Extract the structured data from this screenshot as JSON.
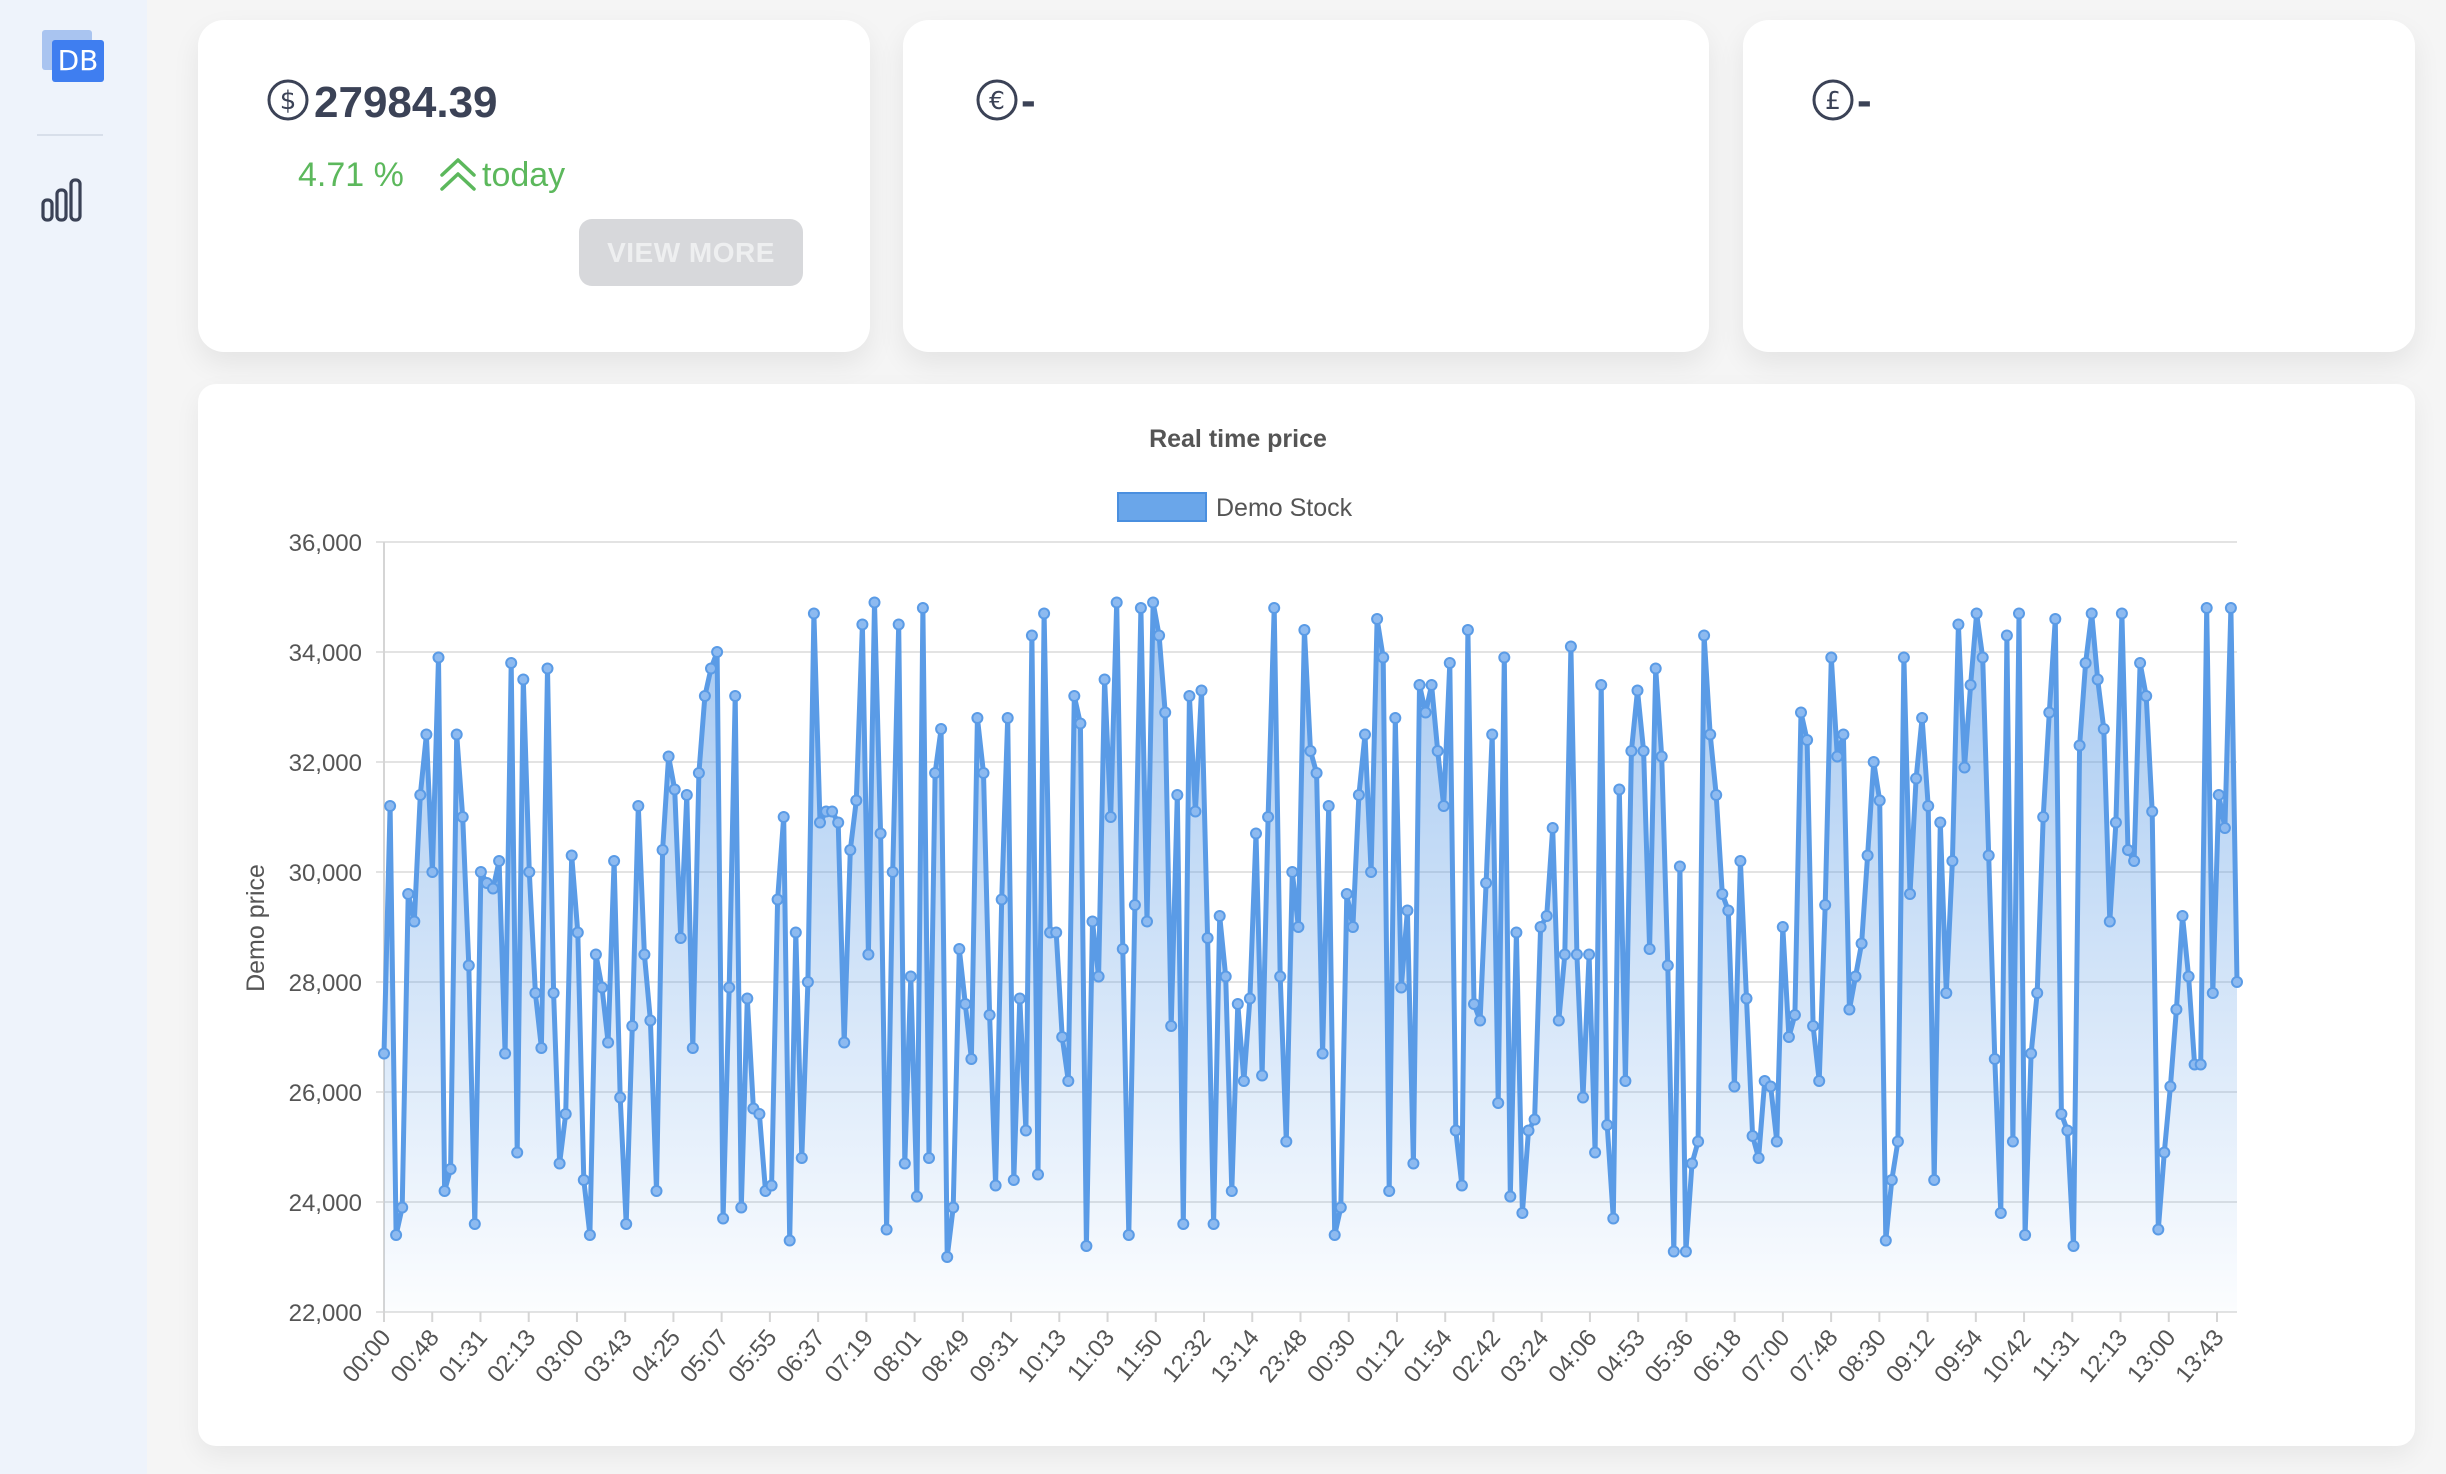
{
  "sidebar": {
    "logo_text": "DB",
    "items": [
      {
        "icon": "bar-chart-icon"
      }
    ]
  },
  "cards": [
    {
      "currency_icon": "dollar-circle-icon",
      "price": "27984.39",
      "change_pct": "4.71 %",
      "arrow_icon": "double-chevron-up-icon",
      "period": "today",
      "button_label": "VIEW MORE"
    },
    {
      "currency_icon": "euro-circle-icon",
      "price": "-"
    },
    {
      "currency_icon": "pound-circle-icon",
      "price": "-"
    }
  ],
  "colors": {
    "line": "#5a9be6",
    "positive": "#5cb85c",
    "logo": "#3f7ef0",
    "sidebar_bg": "#eef3fb"
  },
  "chart_data": {
    "type": "line",
    "title": "Real time price",
    "ylabel": "Demo price",
    "xlabel": "",
    "ylim": [
      22000,
      36000
    ],
    "yticks": [
      22000,
      24000,
      26000,
      28000,
      30000,
      32000,
      34000,
      36000
    ],
    "ytick_labels": [
      "22,000",
      "24,000",
      "26,000",
      "28,000",
      "30,000",
      "32,000",
      "34,000",
      "36,000"
    ],
    "x_tick_labels": [
      "00:00",
      "00:48",
      "01:31",
      "02:13",
      "03:00",
      "03:43",
      "04:25",
      "05:07",
      "05:55",
      "06:37",
      "07:19",
      "08:01",
      "08:49",
      "09:31",
      "10:13",
      "11:03",
      "11:50",
      "12:32",
      "13:14",
      "23:48",
      "00:30",
      "01:12",
      "01:54",
      "02:42",
      "03:24",
      "04:06",
      "04:53",
      "05:36",
      "06:18",
      "07:00",
      "07:48",
      "08:30",
      "09:12",
      "09:54",
      "10:42",
      "11:31",
      "12:13",
      "13:00",
      "13:43"
    ],
    "legend_position": "top",
    "grid": true,
    "fill": true,
    "series": [
      {
        "name": "Demo Stock",
        "values": [
          26700,
          31200,
          23400,
          23900,
          29600,
          29100,
          31400,
          32500,
          30000,
          33900,
          24200,
          24600,
          32500,
          31000,
          28300,
          23600,
          30000,
          29800,
          29700,
          30200,
          26700,
          33800,
          24900,
          33500,
          30000,
          27800,
          26800,
          33700,
          27800,
          24700,
          25600,
          30300,
          28900,
          24400,
          23400,
          28500,
          27900,
          26900,
          30200,
          25900,
          23600,
          27200,
          31200,
          28500,
          27300,
          24200,
          30400,
          32100,
          31500,
          28800,
          31400,
          26800,
          31800,
          33200,
          33700,
          34000,
          23700,
          27900,
          33200,
          23900,
          27700,
          25700,
          25600,
          24200,
          24300,
          29500,
          31000,
          23300,
          28900,
          24800,
          28000,
          34700,
          30900,
          31100,
          31100,
          30900,
          26900,
          30400,
          31300,
          34500,
          28500,
          34900,
          30700,
          23500,
          30000,
          34500,
          24700,
          28100,
          24100,
          34800,
          24800,
          31800,
          32600,
          23000,
          23900,
          28600,
          27600,
          26600,
          32800,
          31800,
          27400,
          24300,
          29500,
          32800,
          24400,
          27700,
          25300,
          34300,
          24500,
          34700,
          28900,
          28900,
          27000,
          26200,
          33200,
          32700,
          23200,
          29100,
          28100,
          33500,
          31000,
          34900,
          28600,
          23400,
          29400,
          34800,
          29100,
          34900,
          34300,
          32900,
          27200,
          31400,
          23600,
          33200,
          31100,
          33300,
          28800,
          23600,
          29200,
          28100,
          24200,
          27600,
          26200,
          27700,
          30700,
          26300,
          31000,
          34800,
          28100,
          25100,
          30000,
          29000,
          34400,
          32200,
          31800,
          26700,
          31200,
          23400,
          23900,
          29600,
          29000,
          31400,
          32500,
          30000,
          34600,
          33900,
          24200,
          32800,
          27900,
          29300,
          24700,
          33400,
          32900,
          33400,
          32200,
          31200,
          33800,
          25300,
          24300,
          34400,
          27600,
          27300,
          29800,
          32500,
          25800,
          33900,
          24100,
          28900,
          23800,
          25300,
          25500,
          29000,
          29200,
          30800,
          27300,
          28500,
          34100,
          28500,
          25900,
          28500,
          24900,
          33400,
          25400,
          23700,
          31500,
          26200,
          32200,
          33300,
          32200,
          28600,
          33700,
          32100,
          28300,
          23100,
          30100,
          23100,
          24700,
          25100,
          34300,
          32500,
          31400,
          29600,
          29300,
          26100,
          30200,
          27700,
          25200,
          24800,
          26200,
          26100,
          25100,
          29000,
          27000,
          27400,
          32900,
          32400,
          27200,
          26200,
          29400,
          33900,
          32100,
          32500,
          27500,
          28100,
          28700,
          30300,
          32000,
          31300,
          23300,
          24400,
          25100,
          33900,
          29600,
          31700,
          32800,
          31200,
          24400,
          30900,
          27800,
          30200,
          34500,
          31900,
          33400,
          34700,
          33900,
          30300,
          26600,
          23800,
          34300,
          25100,
          34700,
          23400,
          26700,
          27800,
          31000,
          32900,
          34600,
          25600,
          25300,
          23200,
          32300,
          33800,
          34700,
          33500,
          32600,
          29100,
          30900,
          34700,
          30400,
          30200,
          33800,
          33200,
          31100,
          23500,
          24900,
          26100,
          27500,
          29200,
          28100,
          26500,
          26500,
          34800,
          27800,
          31400,
          30800,
          34800,
          28000
        ]
      }
    ]
  }
}
